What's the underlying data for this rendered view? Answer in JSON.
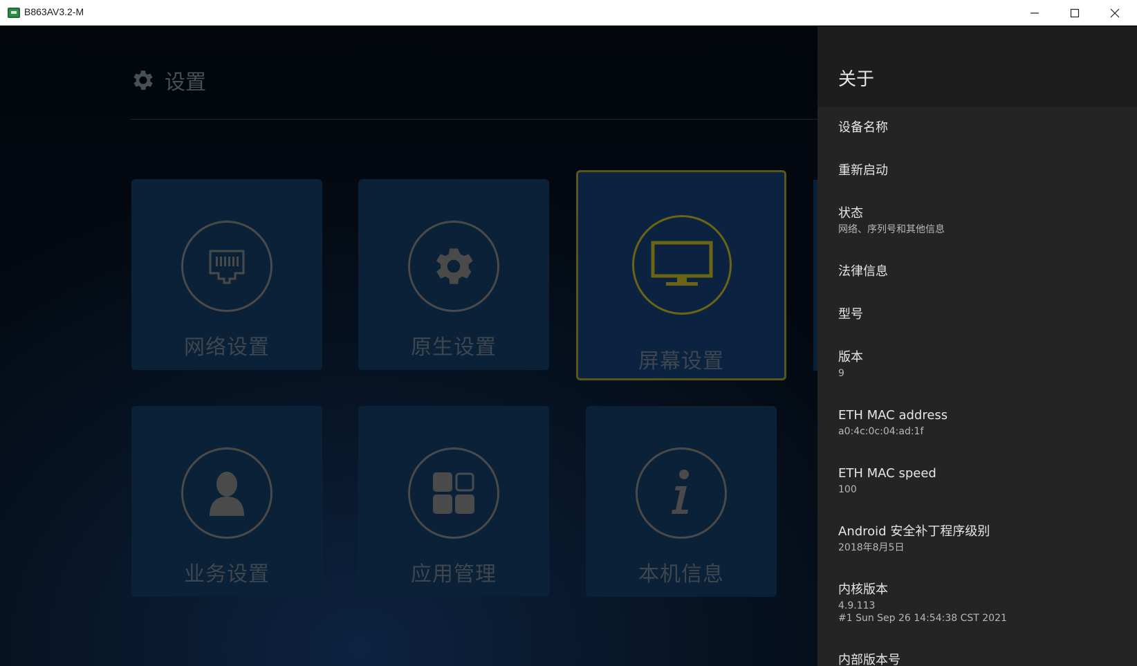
{
  "window": {
    "title": "B863AV3.2-M",
    "icons": {
      "app": "app-icon",
      "minimize": "minimize-icon",
      "maximize": "maximize-icon",
      "close": "close-icon"
    }
  },
  "settings": {
    "header_icon": "gear-icon",
    "header_title": "设置",
    "tiles": [
      {
        "label": "网络设置",
        "icon": "ethernet-port-icon"
      },
      {
        "label": "原生设置",
        "icon": "gear-icon"
      },
      {
        "label": "屏幕设置",
        "icon": "monitor-icon"
      },
      {
        "label": "业务设置",
        "icon": "user-icon"
      },
      {
        "label": "应用管理",
        "icon": "apps-grid-icon"
      },
      {
        "label": "本机信息",
        "icon": "info-icon"
      }
    ]
  },
  "about": {
    "title": "关于",
    "items": [
      {
        "title": "设备名称"
      },
      {
        "title": "重新启动"
      },
      {
        "title": "状态",
        "sub": "网络、序列号和其他信息"
      },
      {
        "title": "法律信息"
      },
      {
        "title": "型号"
      },
      {
        "title": "版本",
        "sub": "9"
      },
      {
        "title": "ETH MAC address",
        "sub": "a0:4c:0c:04:ad:1f"
      },
      {
        "title": "ETH MAC speed",
        "sub": "100"
      },
      {
        "title": "Android 安全补丁程序级别",
        "sub": "2018年8月5日"
      },
      {
        "title": "内核版本",
        "sub": "4.9.113",
        "sub2": "#1 Sun Sep 26 14:54:38 CST 2021"
      },
      {
        "title": "内部版本号"
      }
    ]
  },
  "colors": {
    "drawer_bg": "#242424",
    "tile_bg": "#0a2138",
    "focus_border": "#5a5518"
  }
}
